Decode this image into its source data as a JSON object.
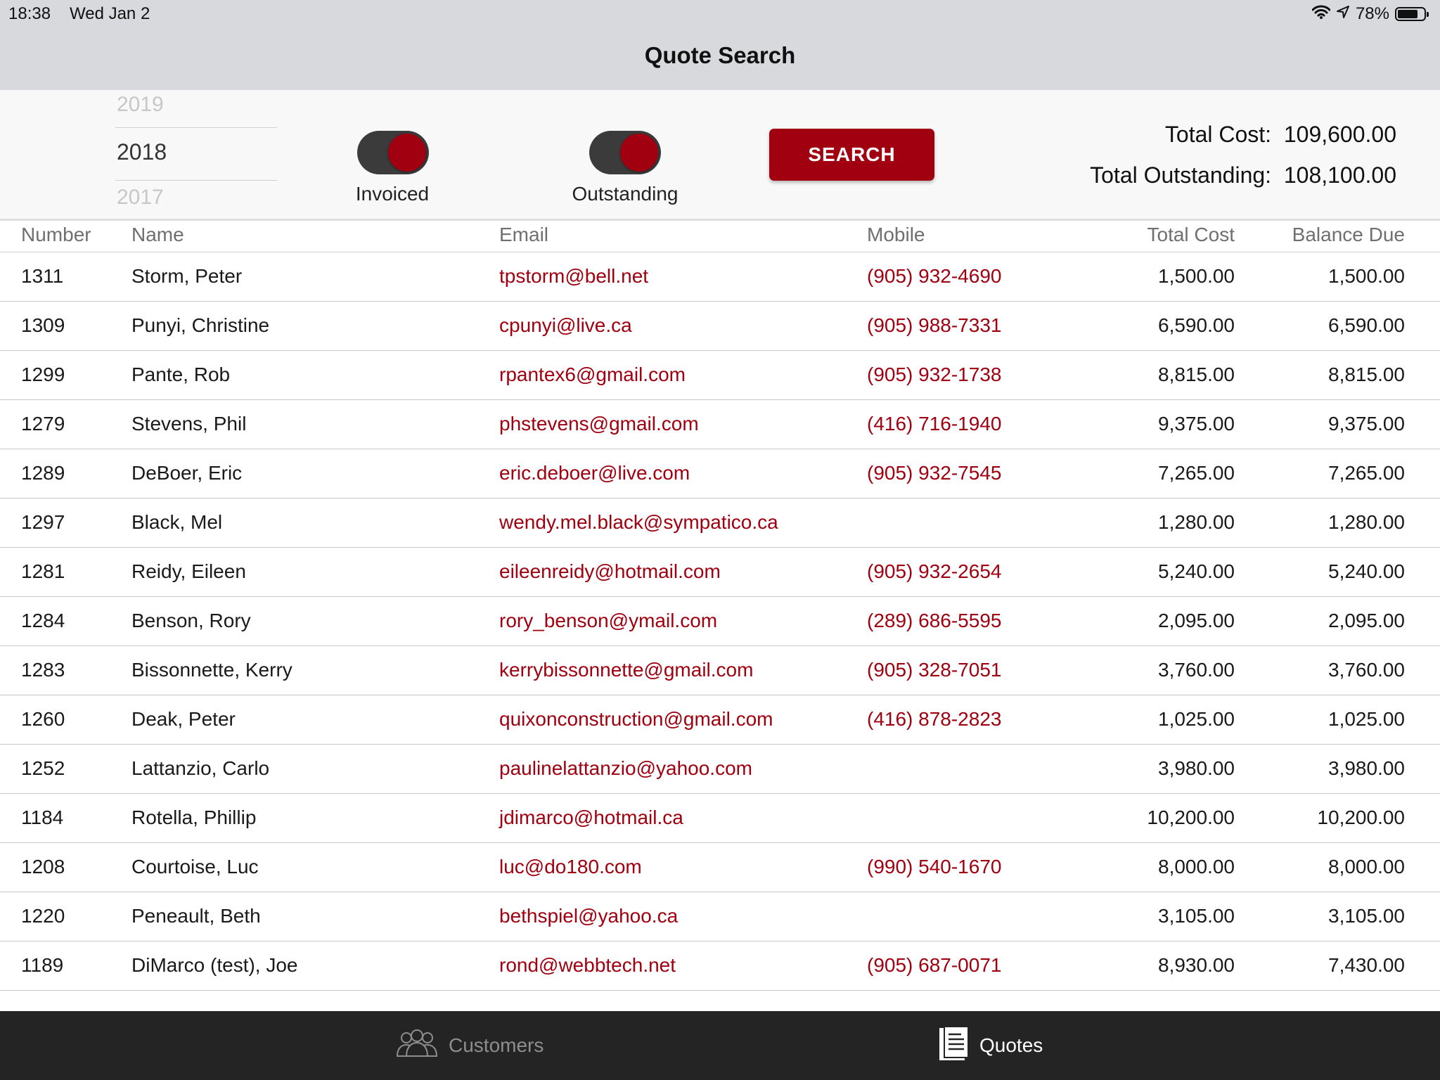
{
  "status_bar": {
    "time": "18:38",
    "date": "Wed Jan 2",
    "battery_percent": "78%",
    "battery_level": 0.78
  },
  "nav": {
    "title": "Quote Search"
  },
  "filters": {
    "year_picker": {
      "above": "2019",
      "selected": "2018",
      "below": "2017"
    },
    "invoiced": {
      "label": "Invoiced",
      "on": true
    },
    "outstanding": {
      "label": "Outstanding",
      "on": true
    },
    "search_label": "SEARCH"
  },
  "totals": {
    "total_cost_label": "Total Cost:",
    "total_cost_value": "109,600.00",
    "total_outstanding_label": "Total Outstanding:",
    "total_outstanding_value": "108,100.00"
  },
  "table": {
    "headers": {
      "number": "Number",
      "name": "Name",
      "email": "Email",
      "mobile": "Mobile",
      "total_cost": "Total Cost",
      "balance_due": "Balance Due"
    },
    "rows": [
      {
        "number": "1311",
        "name": "Storm, Peter",
        "email": "tpstorm@bell.net",
        "mobile": "(905) 932-4690",
        "total": "1,500.00",
        "balance": "1,500.00"
      },
      {
        "number": "1309",
        "name": "Punyi, Christine",
        "email": "cpunyi@live.ca",
        "mobile": "(905) 988-7331",
        "total": "6,590.00",
        "balance": "6,590.00"
      },
      {
        "number": "1299",
        "name": "Pante, Rob",
        "email": "rpantex6@gmail.com",
        "mobile": "(905) 932-1738",
        "total": "8,815.00",
        "balance": "8,815.00"
      },
      {
        "number": "1279",
        "name": "Stevens, Phil",
        "email": "phstevens@gmail.com",
        "mobile": "(416) 716-1940",
        "total": "9,375.00",
        "balance": "9,375.00"
      },
      {
        "number": "1289",
        "name": "DeBoer, Eric",
        "email": "eric.deboer@live.com",
        "mobile": "(905) 932-7545",
        "total": "7,265.00",
        "balance": "7,265.00"
      },
      {
        "number": "1297",
        "name": "Black, Mel",
        "email": "wendy.mel.black@sympatico.ca",
        "mobile": "",
        "total": "1,280.00",
        "balance": "1,280.00"
      },
      {
        "number": "1281",
        "name": "Reidy, Eileen",
        "email": "eileenreidy@hotmail.com",
        "mobile": "(905) 932-2654",
        "total": "5,240.00",
        "balance": "5,240.00"
      },
      {
        "number": "1284",
        "name": "Benson, Rory",
        "email": "rory_benson@ymail.com",
        "mobile": "(289) 686-5595",
        "total": "2,095.00",
        "balance": "2,095.00"
      },
      {
        "number": "1283",
        "name": "Bissonnette, Kerry",
        "email": "kerrybissonnette@gmail.com",
        "mobile": "(905) 328-7051",
        "total": "3,760.00",
        "balance": "3,760.00"
      },
      {
        "number": "1260",
        "name": "Deak, Peter",
        "email": "quixonconstruction@gmail.com",
        "mobile": "(416) 878-2823",
        "total": "1,025.00",
        "balance": "1,025.00"
      },
      {
        "number": "1252",
        "name": "Lattanzio, Carlo",
        "email": "paulinelattanzio@yahoo.com",
        "mobile": "",
        "total": "3,980.00",
        "balance": "3,980.00"
      },
      {
        "number": "1184",
        "name": "Rotella, Phillip",
        "email": "jdimarco@hotmail.ca",
        "mobile": "",
        "total": "10,200.00",
        "balance": "10,200.00"
      },
      {
        "number": "1208",
        "name": "Courtoise, Luc",
        "email": "luc@do180.com",
        "mobile": "(990) 540-1670",
        "total": "8,000.00",
        "balance": "8,000.00"
      },
      {
        "number": "1220",
        "name": "Peneault, Beth",
        "email": "bethspiel@yahoo.ca",
        "mobile": "",
        "total": "3,105.00",
        "balance": "3,105.00"
      },
      {
        "number": "1189",
        "name": "DiMarco (test), Joe",
        "email": "rond@webbtech.net",
        "mobile": "(905) 687-0071",
        "total": "8,930.00",
        "balance": "7,430.00"
      }
    ]
  },
  "tabbar": {
    "customers": {
      "label": "Customers",
      "icon": "customers-icon"
    },
    "quotes": {
      "label": "Quotes",
      "icon": "quotes-icon"
    }
  },
  "colors": {
    "accent": "#a0000f",
    "nav_bg": "#d8d9dc",
    "tabbar_bg": "#242424"
  }
}
